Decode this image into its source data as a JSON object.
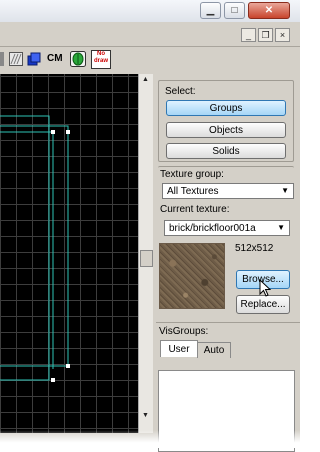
{
  "toolbar": {
    "cm_label": "CM",
    "no_draw_label_line1": "No",
    "no_draw_label_line2": "draw"
  },
  "select": {
    "label": "Select:",
    "groups_label": "Groups",
    "objects_label": "Objects",
    "solids_label": "Solids"
  },
  "texture_group": {
    "label": "Texture group:",
    "value": "All Textures"
  },
  "current_texture": {
    "label": "Current texture:",
    "value": "brick/brickfloor001a",
    "size": "512x512"
  },
  "actions": {
    "browse_label": "Browse...",
    "replace_label": "Replace..."
  },
  "visgroups": {
    "label": "VisGroups:",
    "tabs": [
      "User",
      "Auto"
    ]
  },
  "icons": {
    "minimize": "minimize-icon",
    "maximize": "maximize-icon",
    "close": "close-icon",
    "restore": "restore-icon"
  },
  "colors": {
    "grid_line": "#3d3d3d",
    "selection_line": "#2ec4b6",
    "selection_vertex": "#ffffff",
    "active_button": "#a6d6f7"
  }
}
